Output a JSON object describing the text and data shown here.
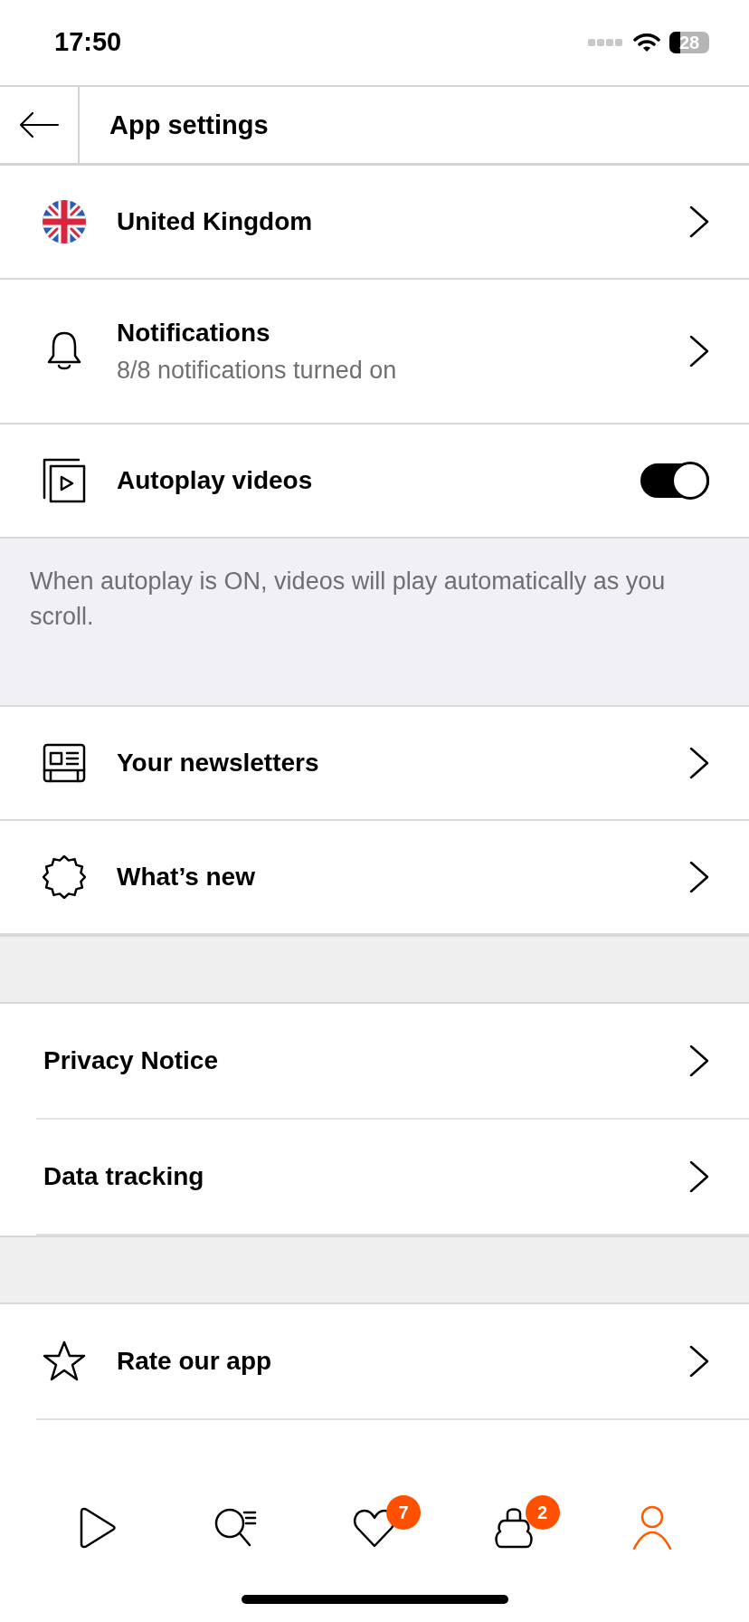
{
  "status_bar": {
    "time": "17:50",
    "battery": "28"
  },
  "header": {
    "title": "App settings"
  },
  "sections": [
    {
      "kind": "list",
      "items": [
        {
          "kind": "link",
          "label": "United Kingdom"
        },
        {
          "kind": "link",
          "label": "Notifications",
          "subtitle": "8/8 notifications turned on"
        },
        {
          "kind": "toggle",
          "label": "Autoplay videos",
          "on": true
        }
      ]
    },
    {
      "kind": "note",
      "text": "When autoplay is ON, videos will play automatically as you scroll."
    },
    {
      "kind": "list",
      "items": [
        {
          "kind": "link",
          "label": "Your newsletters"
        },
        {
          "kind": "link",
          "label": "What’s new"
        }
      ]
    },
    {
      "kind": "gap"
    },
    {
      "kind": "inset_list",
      "items": [
        {
          "kind": "link",
          "label": "Privacy Notice"
        },
        {
          "kind": "link",
          "label": "Data tracking"
        }
      ]
    },
    {
      "kind": "gap"
    },
    {
      "kind": "inset_list",
      "items": [
        {
          "kind": "link",
          "label": "Rate our app"
        }
      ]
    }
  ],
  "tab_bar": [
    {
      "selected": false
    },
    {
      "selected": false
    },
    {
      "selected": false,
      "count": "7"
    },
    {
      "selected": false,
      "count": "2"
    },
    {
      "selected": true
    }
  ]
}
